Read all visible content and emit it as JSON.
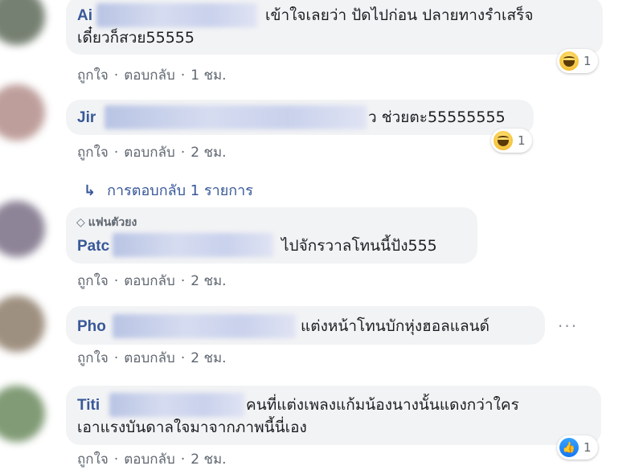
{
  "comments": [
    {
      "name": "Ai",
      "text_line1": "เข้าใจเลยว่า ปัดไปก่อน ปลายทางรำเสร็จ",
      "text_line2": "เดี๋ยวก็สวย55555",
      "like": "ถูกใจ",
      "reply": "ตอบกลับ",
      "time": "1 ชม.",
      "reaction": {
        "type": "haha",
        "count": "1"
      }
    },
    {
      "name": "Jir",
      "text_tail": "ว ช่วยตะ55555555",
      "like": "ถูกใจ",
      "reply": "ตอบกลับ",
      "time": "2 ชม.",
      "reaction": {
        "type": "haha",
        "count": "1"
      }
    },
    {
      "badge": "แฟนตัวยง",
      "name": "Patc",
      "text": "ไปจักรวาลโทนนี้ปัง555",
      "like": "ถูกใจ",
      "reply": "ตอบกลับ",
      "time": "2 ชม."
    },
    {
      "name": "Pho",
      "text": "แต่งหน้าโทนบักหุ่งฮอลแลนด์",
      "like": "ถูกใจ",
      "reply": "ตอบกลับ",
      "time": "2 ชม."
    },
    {
      "name": "Titi",
      "text_line1": "คนที่แต่งเพลงแก้มน้องนางนั้นแดงกว่าใคร",
      "text_line2": "เอาแรงบันดาลใจมาจากภาพนี้นี่เอง",
      "like": "ถูกใจ",
      "reply": "ตอบกลับ",
      "time": "2 ชม.",
      "reaction": {
        "type": "like",
        "count": "1"
      }
    }
  ],
  "replies_link": {
    "label": "การตอบกลับ 1 รายการ"
  },
  "colors": {
    "name": "#385898",
    "bubble": "#f2f3f5",
    "meta": "#606770"
  },
  "icons": {
    "reply_arrow": "reply-arrow-icon",
    "fan_badge": "diamond-icon",
    "more": "more-options-icon",
    "haha": "haha-reaction-icon",
    "like": "like-reaction-icon"
  }
}
